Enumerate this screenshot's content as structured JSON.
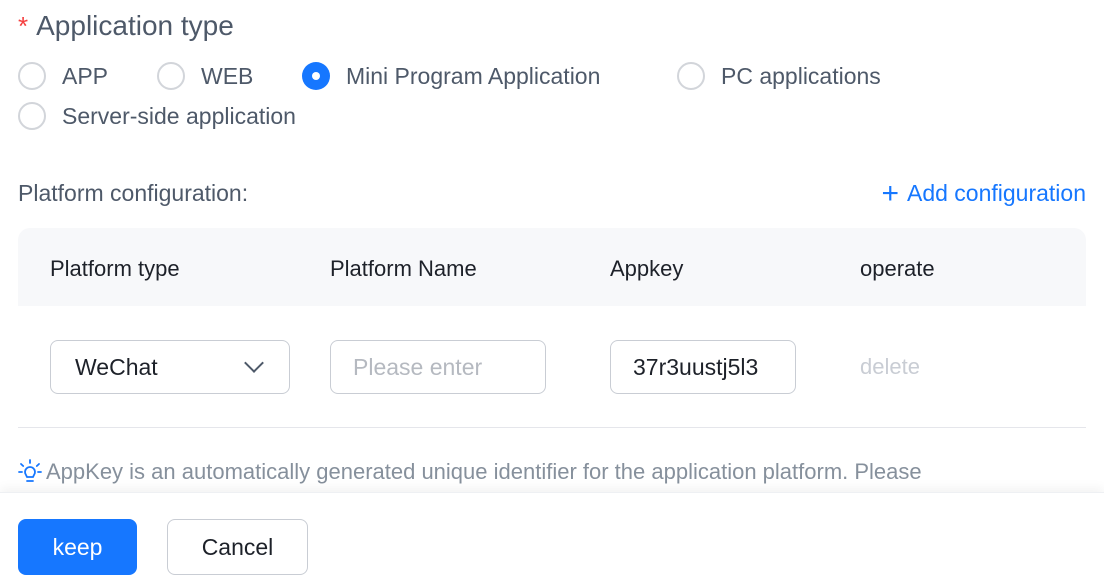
{
  "application_type": {
    "label": "Application type",
    "required_mark": "*",
    "options": [
      {
        "label": "APP",
        "checked": false
      },
      {
        "label": "WEB",
        "checked": false
      },
      {
        "label": "Mini Program Application",
        "checked": true
      },
      {
        "label": "PC applications",
        "checked": false
      },
      {
        "label": "Server-side application",
        "checked": false
      }
    ]
  },
  "platform": {
    "label": "Platform configuration:",
    "add_label": "Add configuration",
    "columns": [
      "Platform type",
      "Platform Name",
      "Appkey",
      "operate"
    ],
    "rows": [
      {
        "platform_type": "WeChat",
        "platform_name_value": "",
        "platform_name_placeholder": "Please enter",
        "appkey": "37r3uustj5l3",
        "operate": "delete"
      }
    ]
  },
  "hint": {
    "text": "AppKey is an automatically generated unique identifier for the application platform. Please"
  },
  "footer": {
    "keep_label": "keep",
    "cancel_label": "Cancel"
  },
  "colors": {
    "primary": "#1677ff",
    "required": "#f53f3f",
    "hint_icon": "#1677ff"
  },
  "icons": {
    "add": "plus-icon",
    "select": "chevron-down-icon",
    "hint": "lightbulb-icon"
  }
}
